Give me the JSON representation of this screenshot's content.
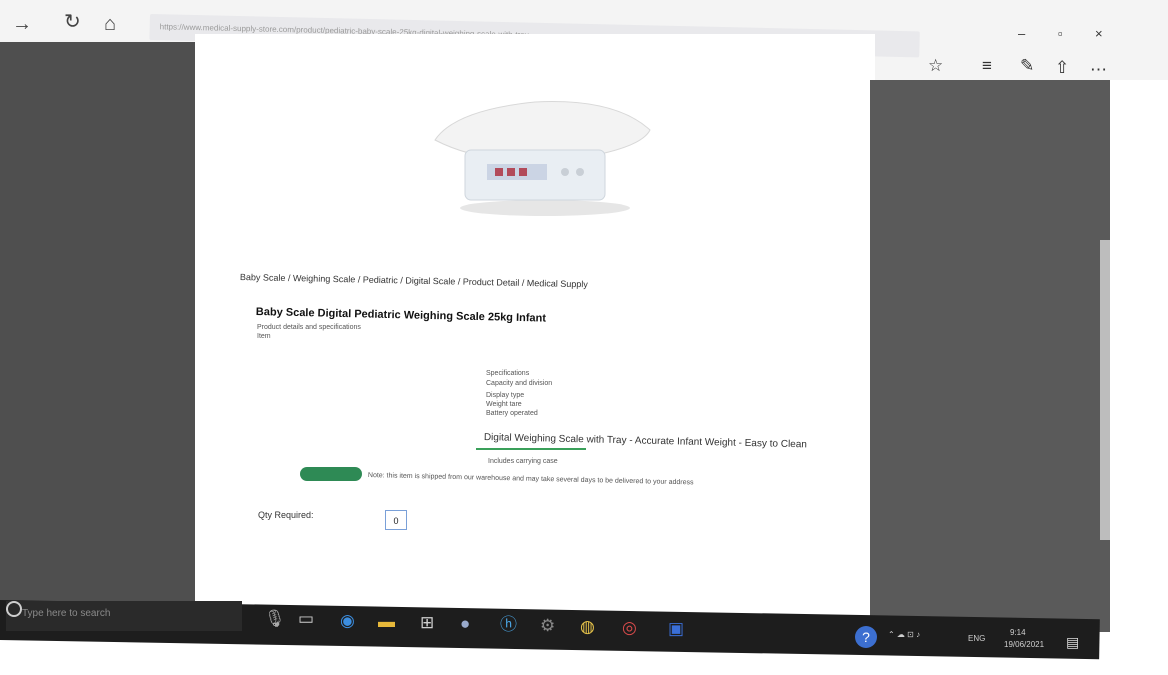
{
  "browser": {
    "address": "https://www.medical-supply-store.com/product/pediatric-baby-scale-25kg-digital-weighing-scale-with-tray",
    "nav": {
      "back": "←",
      "forward": "→",
      "refresh": "↻",
      "home": "⌂"
    },
    "window": {
      "minimize": "–",
      "maximize": "▫",
      "close": "×"
    },
    "toolbar": {
      "favorite": "☆",
      "reading_list": "≡",
      "notes": "✎",
      "share": "⇧",
      "more": "⋯"
    }
  },
  "product": {
    "breadcrumb": "Baby Scale / Weighing Scale / Pediatric / Digital Scale / Product Detail / Medical Supply",
    "title": "Baby Scale Digital Pediatric Weighing Scale 25kg Infant",
    "subtitle": "Product details and specifications",
    "sub2": "Item",
    "spec_lines": [
      "Specifications",
      "Capacity and division",
      "Display type",
      "Weight tare",
      "Battery operated"
    ],
    "feature_line": "Digital Weighing Scale with Tray - Accurate Infant Weight - Easy to Clean",
    "feature_sub": "Includes carrying case",
    "badge_note": "Note: this item is shipped from our warehouse and may take several days to be delivered to your address",
    "qty_label": "Qty Required:",
    "qty_value": "0"
  },
  "taskbar": {
    "search_placeholder": "Type here to search",
    "icons": [
      "mic-icon",
      "task-view-icon",
      "edge-icon",
      "file-explorer-icon",
      "store-icon",
      "app-icon",
      "hp-icon",
      "settings-icon",
      "chrome-icon",
      "photos-icon",
      "word-icon"
    ],
    "time": "9:14",
    "date": "19/06/2021",
    "lang": "ENG"
  },
  "colors": {
    "left_panel": "#4f4f4f",
    "right_panel": "#5a5a5a",
    "taskbar": "#1d1d1d",
    "badge": "#2e8a55"
  }
}
